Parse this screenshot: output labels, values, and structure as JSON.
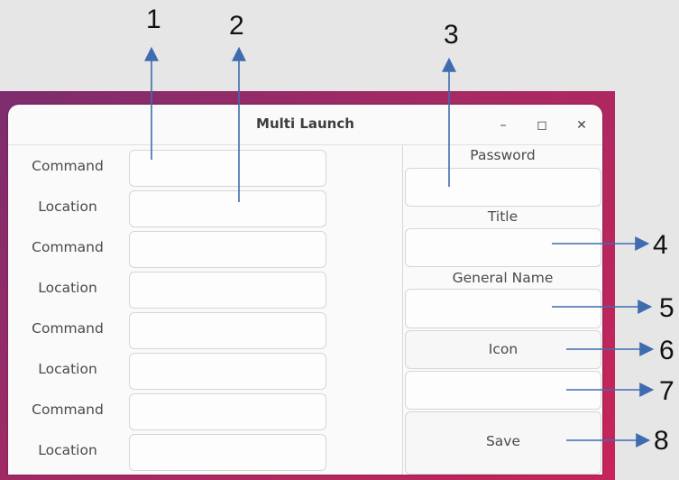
{
  "window": {
    "title": "Multi Launch",
    "minimize_symbol": "–",
    "maximize_symbol": "◻",
    "close_symbol": "✕"
  },
  "left_rows": [
    {
      "label": "Command",
      "value": ""
    },
    {
      "label": "Location",
      "value": ""
    },
    {
      "label": "Command",
      "value": ""
    },
    {
      "label": "Location",
      "value": ""
    },
    {
      "label": "Command",
      "value": ""
    },
    {
      "label": "Location",
      "value": ""
    },
    {
      "label": "Command",
      "value": ""
    },
    {
      "label": "Location",
      "value": ""
    }
  ],
  "right_panel": {
    "password_label": "Password",
    "password_value": "",
    "title_label": "Title",
    "title_value": "",
    "general_name_label": "General Name",
    "general_name_value": "",
    "icon_button": "Icon",
    "extra_value": "",
    "save_button": "Save"
  },
  "callouts": [
    "1",
    "2",
    "3",
    "4",
    "5",
    "6",
    "7",
    "8"
  ],
  "colors": {
    "arrow": "#3f6cb0",
    "desktop": "#a52a63"
  }
}
